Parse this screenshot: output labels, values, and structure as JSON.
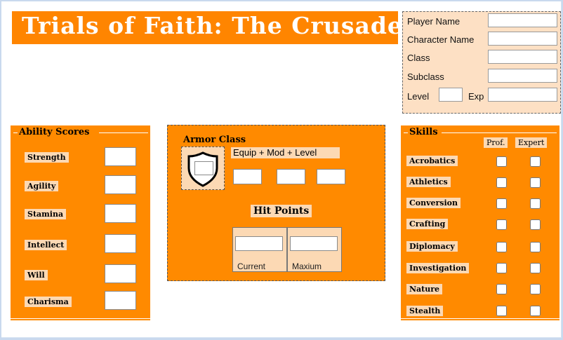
{
  "title": "Trials of Faith: The Crusades",
  "player_info": {
    "player_name_label": "Player Name",
    "character_name_label": "Character Name",
    "class_label": "Class",
    "subclass_label": "Subclass",
    "level_label": "Level",
    "exp_label": "Exp",
    "player_name_value": "",
    "character_name_value": "",
    "class_value": "",
    "subclass_value": "",
    "level_value": "",
    "exp_value": ""
  },
  "abilities": {
    "heading": "Ability Scores",
    "items": [
      "Strength",
      "Agility",
      "Stamina",
      "Intellect",
      "Will",
      "Charisma"
    ]
  },
  "armor": {
    "heading": "Armor Class",
    "header_line": "Equip  +  Mod  +  Level",
    "hp_heading": "Hit Points",
    "current_label": "Current",
    "max_label": "Maxium"
  },
  "skills": {
    "heading": "Skills",
    "prof_label": "Prof.",
    "expert_label": "Expert",
    "items": [
      "Acrobatics",
      "Athletics",
      "Conversion",
      "Crafting",
      "Diplomacy",
      "Investigation",
      "Nature",
      "Stealth"
    ]
  },
  "colors": {
    "accent": "#ff8a00",
    "panel_light": "#fcd9b4",
    "background": "#c9d9ee"
  }
}
